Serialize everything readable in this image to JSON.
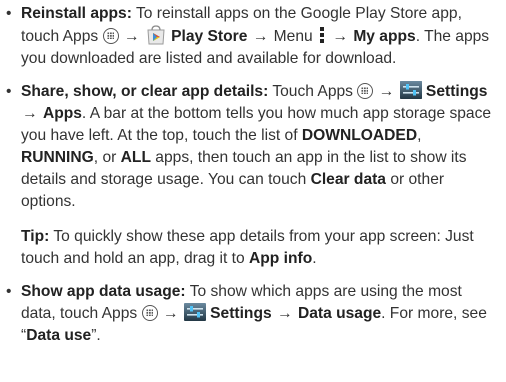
{
  "bullet": "•",
  "arrow": "→",
  "sections": {
    "reinstall": {
      "title": "Reinstall apps:",
      "t1": " To reinstall apps on the Google Play Store app, touch Apps ",
      "play_store": "Play Store",
      "t2": " Menu ",
      "my_apps": "My apps",
      "t3": ". The apps you downloaded are listed and available for download."
    },
    "share": {
      "title": "Share, show, or clear app details:",
      "t1": " Touch Apps ",
      "settings": "Settings",
      "apps": "Apps",
      "t2": ". A bar at the bottom tells you how much app storage space you have left. At the top, touch the list of ",
      "downloaded": "DOWNLOADED",
      "comma": ", ",
      "running": "RUNNING",
      "or": ", or ",
      "all": "ALL",
      "t3": " apps, then touch an app in the list to show its details and storage usage. You can touch ",
      "clear_data": "Clear data",
      "t4": " or other options."
    },
    "tip": {
      "label": "Tip:",
      "t1": " To quickly show these app details from your app screen: Just touch and hold an app, drag it to ",
      "app_info": "App info",
      "t2": "."
    },
    "data_usage": {
      "title": "Show app data usage:",
      "t1": " To show which apps are using the most data, touch Apps ",
      "settings": "Settings",
      "data_usage": "Data usage",
      "t2": ". For more, see “",
      "data_use": "Data use",
      "t3": "”."
    }
  },
  "icons": [
    "apps-icon",
    "play-store-icon",
    "menu-icon",
    "settings-icon"
  ]
}
